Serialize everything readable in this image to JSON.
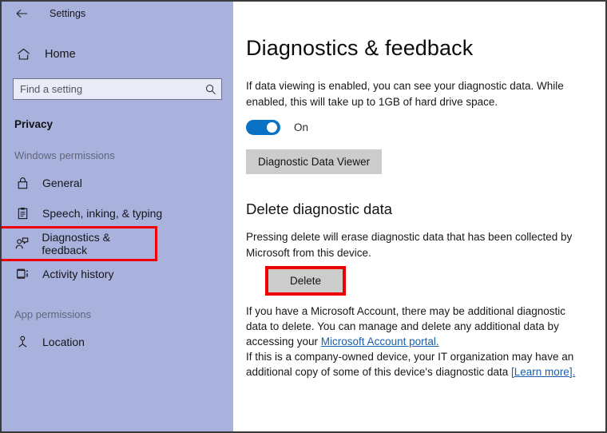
{
  "titlebar": {
    "back_icon": "back-arrow-icon",
    "title": "Settings"
  },
  "sidebar": {
    "home": {
      "icon": "home-icon",
      "label": "Home"
    },
    "search": {
      "value": "",
      "placeholder": "Find a setting",
      "icon": "search-icon"
    },
    "section_title": "Privacy",
    "groups": [
      {
        "label": "Windows permissions",
        "items": [
          {
            "icon": "lock-icon",
            "label": "General",
            "highlighted": false
          },
          {
            "icon": "clipboard-pen-icon",
            "label": "Speech, inking, & typing",
            "highlighted": false
          },
          {
            "icon": "person-feedback-icon",
            "label": "Diagnostics & feedback",
            "highlighted": true
          },
          {
            "icon": "activity-history-icon",
            "label": "Activity history",
            "highlighted": false
          }
        ]
      },
      {
        "label": "App permissions",
        "items": [
          {
            "icon": "location-pin-icon",
            "label": "Location",
            "highlighted": false
          }
        ]
      }
    ]
  },
  "main": {
    "page_title": "Diagnostics & feedback",
    "data_viewing_text": "If data viewing is enabled, you can see your diagnostic data. While enabled, this will take up to 1GB of hard drive space.",
    "toggle": {
      "state": "On",
      "label": "On"
    },
    "data_viewer_button": "Diagnostic Data Viewer",
    "delete_section": {
      "heading": "Delete diagnostic data",
      "description": "Pressing delete will erase diagnostic data that has been collected by Microsoft from this device.",
      "delete_button": "Delete",
      "account_text_before": "If you have a Microsoft Account, there may be additional diagnostic data to delete. You can manage and delete any additional data by accessing your ",
      "account_link": "Microsoft Account portal.",
      "company_text_before": "If this is a company-owned device, your IT organization may have an additional copy of some of this device's diagnostic data ",
      "company_link": "[Learn more].",
      "company_text_after": ""
    }
  },
  "colors": {
    "sidebar_bg": "#a8b2dc",
    "accent_blue": "#0a72c4",
    "highlight_red": "#ee0000",
    "link_blue": "#1a5fa8",
    "button_gray": "#cccccc"
  }
}
